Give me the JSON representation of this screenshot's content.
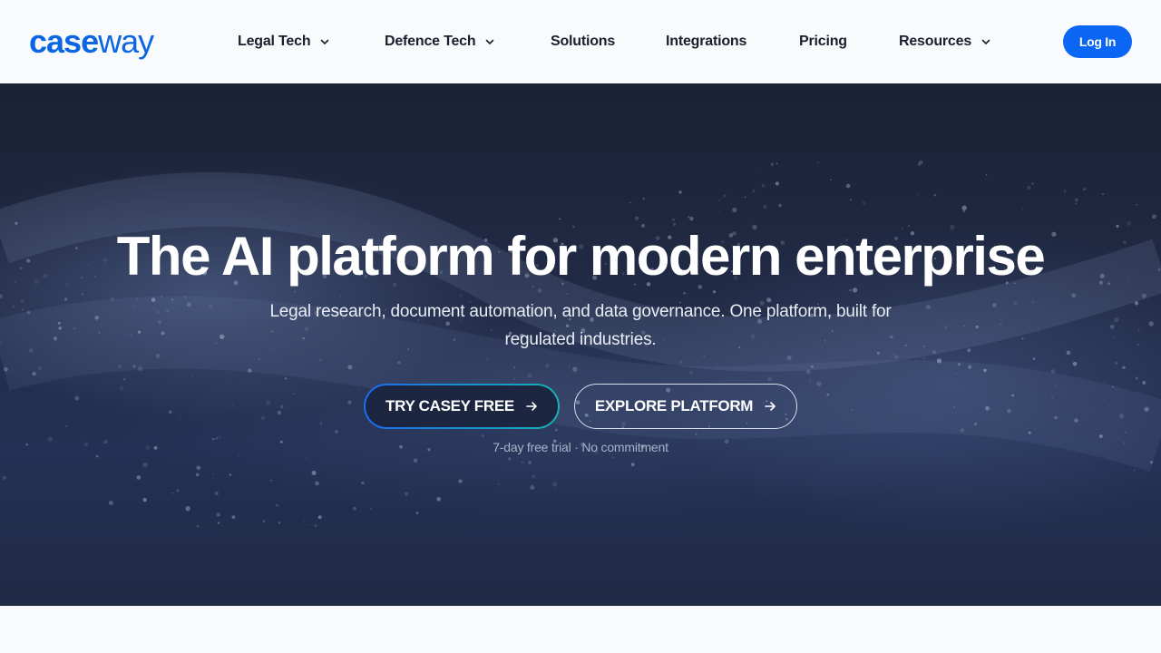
{
  "brand": {
    "logo_bold": "case",
    "logo_light": "way",
    "color": "#0b66e4"
  },
  "nav": {
    "items": [
      {
        "label": "Legal Tech",
        "has_dropdown": true
      },
      {
        "label": "Defence Tech",
        "has_dropdown": true
      },
      {
        "label": "Solutions",
        "has_dropdown": false
      },
      {
        "label": "Integrations",
        "has_dropdown": false
      },
      {
        "label": "Pricing",
        "has_dropdown": false
      },
      {
        "label": "Resources",
        "has_dropdown": true
      }
    ],
    "login_label": "Log In"
  },
  "hero": {
    "title": "The AI platform for modern enterprise",
    "subtitle": "Legal research, document automation, and data governance. One platform, built for regulated industries.",
    "primary_cta": "TRY CASEY FREE",
    "secondary_cta": "EXPLORE PLATFORM",
    "note": "7-day free trial · No commitment"
  },
  "colors": {
    "accent": "#0b66f5",
    "hero_bg": "#222c48",
    "gradient_start": "#1a6cf0",
    "gradient_end": "#18b0b0"
  }
}
